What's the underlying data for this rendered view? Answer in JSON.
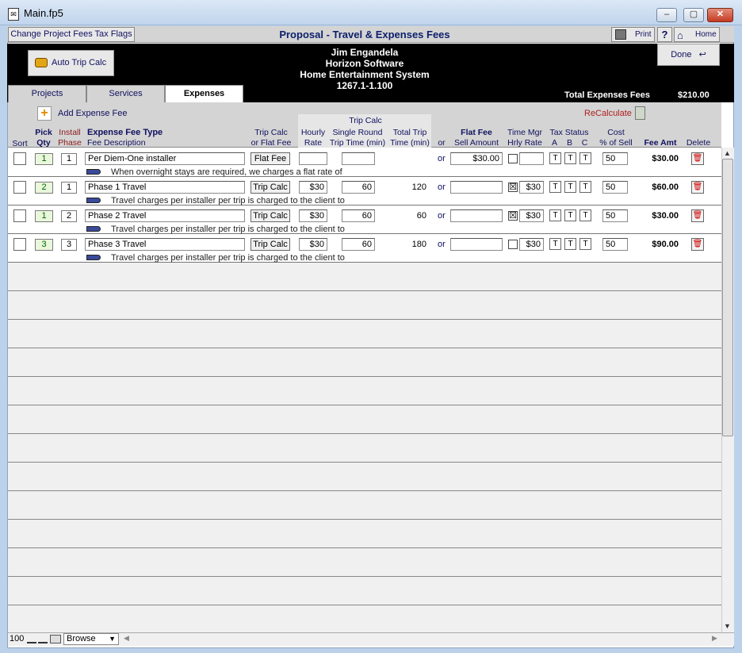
{
  "window": {
    "title": "Main.fp5"
  },
  "topbar": {
    "change_flags": "Change Project Fees Tax Flags",
    "title": "Proposal - Travel & Expenses Fees",
    "print": "Print",
    "help": "?",
    "home": "Home"
  },
  "header": {
    "auto_trip": "Auto Trip Calc",
    "client_name": "Jim Engandela",
    "company": "Horizon Software",
    "project": "Home Entertainment System",
    "project_no": "1267.1-1.100",
    "done": "Done",
    "total_label": "Total Expenses Fees",
    "total_value": "$210.00"
  },
  "tabs": [
    "Projects",
    "Services",
    "Expenses"
  ],
  "toolbar": {
    "add": "Add Expense Fee",
    "recalc": "ReCalculate"
  },
  "columns": {
    "sort": "Sort",
    "pick": "Pick",
    "qty": "Qty",
    "install": "Install",
    "phase": "Phase",
    "type": "Expense Fee Type",
    "desc": "Fee Description",
    "trip_or_flat1": "Trip Calc",
    "trip_or_flat2": "or Flat Fee",
    "trip_calc_group": "Trip Calc",
    "hourly1": "Hourly",
    "hourly2": "Rate",
    "single1": "Single Round",
    "single2": "Trip Time (min)",
    "total1": "Total Trip",
    "total2": "Time (min)",
    "or": "or",
    "flat1": "Flat Fee",
    "flat2": "Sell Amount",
    "tm1": "Time Mgr",
    "tm2": "Hrly Rate",
    "tax": "Tax Status",
    "tax_a": "A",
    "tax_b": "B",
    "tax_c": "C",
    "cost1": "Cost",
    "cost2": "% of Sell",
    "fee_amt": "Fee Amt",
    "delete": "Delete"
  },
  "rows": [
    {
      "qty": "1",
      "phase": "1",
      "name": "Per Diem-One installer",
      "mode": "Flat Fee",
      "rate": "",
      "single": "",
      "total": "",
      "or": "or",
      "flat": "$30.00",
      "tm_checked": "",
      "tm_rate": "",
      "ta": "T",
      "tb": "T",
      "tc": "T",
      "cost": "50",
      "fee": "$30.00",
      "desc": "When overnight stays are required, we charges a flat rate of"
    },
    {
      "qty": "2",
      "phase": "1",
      "name": "Phase 1 Travel",
      "mode": "Trip Calc",
      "rate": "$30",
      "single": "60",
      "total": "120",
      "or": "or",
      "flat": "",
      "tm_checked": "☒",
      "tm_rate": "$30",
      "ta": "T",
      "tb": "T",
      "tc": "T",
      "cost": "50",
      "fee": "$60.00",
      "desc": "Travel charges per installer per trip is charged to the client to"
    },
    {
      "qty": "1",
      "phase": "2",
      "name": "Phase 2 Travel",
      "mode": "Trip Calc",
      "rate": "$30",
      "single": "60",
      "total": "60",
      "or": "or",
      "flat": "",
      "tm_checked": "☒",
      "tm_rate": "$30",
      "ta": "T",
      "tb": "T",
      "tc": "T",
      "cost": "50",
      "fee": "$30.00",
      "desc": "Travel charges per installer per trip is charged to the client to"
    },
    {
      "qty": "3",
      "phase": "3",
      "name": "Phase 3 Travel",
      "mode": "Trip Calc",
      "rate": "$30",
      "single": "60",
      "total": "180",
      "or": "or",
      "flat": "",
      "tm_checked": "",
      "tm_rate": "$30",
      "ta": "T",
      "tb": "T",
      "tc": "T",
      "cost": "50",
      "fee": "$90.00",
      "desc": "Travel charges per installer per trip is charged to the client to"
    }
  ],
  "statusbar": {
    "zoom": "100",
    "mode": "Browse"
  }
}
